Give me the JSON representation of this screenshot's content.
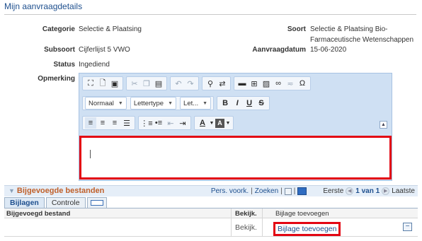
{
  "page": {
    "title": "Mijn aanvraagdetails"
  },
  "details": {
    "categorie_label": "Categorie",
    "categorie_value": "Selectie & Plaatsing",
    "soort_label": "Soort",
    "soort_value_line1": "Selectie & Plaatsing Bio-",
    "soort_value_line2": "Farmaceutische Wetenschappen",
    "subsoort_label": "Subsoort",
    "subsoort_value": "Cijferlijst 5 VWO",
    "aanvraagdatum_label": "Aanvraagdatum",
    "aanvraagdatum_value": "15-06-2020",
    "status_label": "Status",
    "status_value": "Ingediend",
    "opmerking_label": "Opmerking"
  },
  "editor": {
    "format_select": "Normaal",
    "font_select": "Lettertype",
    "size_select": "Let...",
    "icons": [
      "maximize-icon",
      "preview-icon",
      "print-icon",
      "cut-icon",
      "copy-icon",
      "paste-icon",
      "undo-icon",
      "redo-icon",
      "find-icon",
      "replace-icon",
      "horizontal-rule-icon",
      "table-icon",
      "image-icon",
      "link-icon",
      "unlink-icon",
      "special-char-icon",
      "bold-icon",
      "italic-icon",
      "underline-icon",
      "strike-icon",
      "align-left-icon",
      "align-center-icon",
      "align-right-icon",
      "justify-icon",
      "numbered-list-icon",
      "bullet-list-icon",
      "outdent-icon",
      "indent-icon",
      "text-color-icon",
      "bg-color-icon"
    ],
    "bold": "B",
    "italic": "I",
    "underline": "U",
    "strike": "S",
    "omega": "Ω",
    "text_color": "A",
    "bg_color": "A"
  },
  "grid": {
    "title": "Bijgevoegde bestanden",
    "pers_voork": "Pers. voork.",
    "zoeken": "Zoeken",
    "eerste": "Eerste",
    "range": "1 van 1",
    "laatste": "Laatste",
    "tabs": [
      "Bijlagen",
      "Controle"
    ],
    "columns": [
      "Bijgevoegd bestand",
      "Bekijk.",
      "Bijlage toevoegen"
    ],
    "rows": [
      {
        "bestand": "",
        "bekijk": "Bekijk.",
        "toevoegen": "Bijlage toevoegen"
      }
    ]
  },
  "colors": {
    "title_blue": "#1e4f8e",
    "highlight_red": "#e30613",
    "section_orange": "#c0602a",
    "editor_bg": "#cfe0f3"
  }
}
